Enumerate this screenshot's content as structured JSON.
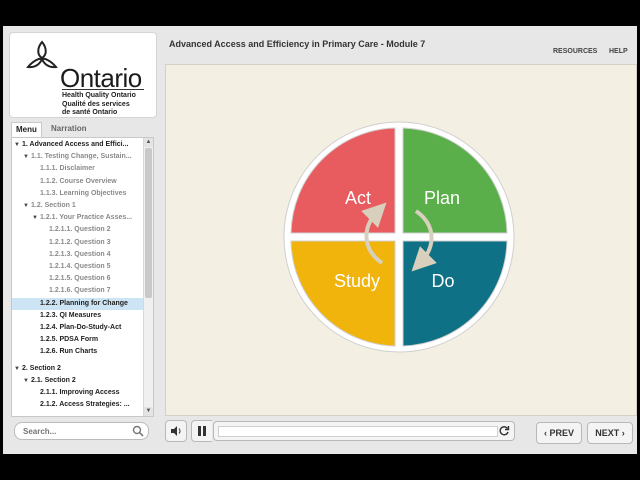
{
  "header": {
    "course_title": "Advanced Access and Efficiency in Primary Care - Module 7",
    "resources_label": "RESOURCES",
    "help_label": "HELP"
  },
  "logo": {
    "wordmark": "Ontario",
    "line1": "Health Quality Ontario",
    "line2": "Qualité des services",
    "line3": "de santé Ontario"
  },
  "sidebar": {
    "tabs": [
      "Menu",
      "Narration"
    ],
    "active_tab": "Menu",
    "items": [
      {
        "label": "1. Advanced Access and Effici...",
        "caret": "▼",
        "dim": false
      },
      {
        "label": "1.1. Testing Change, Sustain...",
        "caret": "▼",
        "dim": true
      },
      {
        "label": "1.1.1. Disclaimer",
        "caret": "",
        "dim": true
      },
      {
        "label": "1.1.2. Course Overview",
        "caret": "",
        "dim": true
      },
      {
        "label": "1.1.3. Learning Objectives",
        "caret": "",
        "dim": true
      },
      {
        "label": "1.2. Section 1",
        "caret": "▼",
        "dim": true
      },
      {
        "label": "1.2.1. Your Practice Asses...",
        "caret": "▼",
        "dim": true
      },
      {
        "label": "1.2.1.1. Question 2",
        "caret": "",
        "dim": true
      },
      {
        "label": "1.2.1.2. Question 3",
        "caret": "",
        "dim": true
      },
      {
        "label": "1.2.1.3. Question 4",
        "caret": "",
        "dim": true
      },
      {
        "label": "1.2.1.4. Question 5",
        "caret": "",
        "dim": true
      },
      {
        "label": "1.2.1.5. Question 6",
        "caret": "",
        "dim": true
      },
      {
        "label": "1.2.1.6. Question 7",
        "caret": "",
        "dim": true
      },
      {
        "label": "1.2.2. Planning for Change",
        "caret": "",
        "dim": false,
        "selected": true
      },
      {
        "label": "1.2.3. QI Measures",
        "caret": "",
        "dim": false
      },
      {
        "label": "1.2.4. Plan-Do-Study-Act",
        "caret": "",
        "dim": false
      },
      {
        "label": "1.2.5. PDSA Form",
        "caret": "",
        "dim": false
      },
      {
        "label": "1.2.6. Run Charts",
        "caret": "",
        "dim": false
      },
      {
        "label": "2. Section 2",
        "caret": "▼",
        "dim": false
      },
      {
        "label": "2.1. Section 2",
        "caret": "▼",
        "dim": false
      },
      {
        "label": "2.1.1. Improving Access",
        "caret": "",
        "dim": false
      },
      {
        "label": "2.1.2. Access Strategies: ...",
        "caret": "",
        "dim": false
      }
    ],
    "search_placeholder": "Search..."
  },
  "diagram": {
    "quadrants": [
      {
        "label": "Act",
        "color": "#e85c5f"
      },
      {
        "label": "Plan",
        "color": "#5aaf4a"
      },
      {
        "label": "Study",
        "color": "#f0b40c"
      },
      {
        "label": "Do",
        "color": "#0e7185"
      }
    ]
  },
  "player": {
    "prev_label": "PREV",
    "next_label": "NEXT"
  }
}
